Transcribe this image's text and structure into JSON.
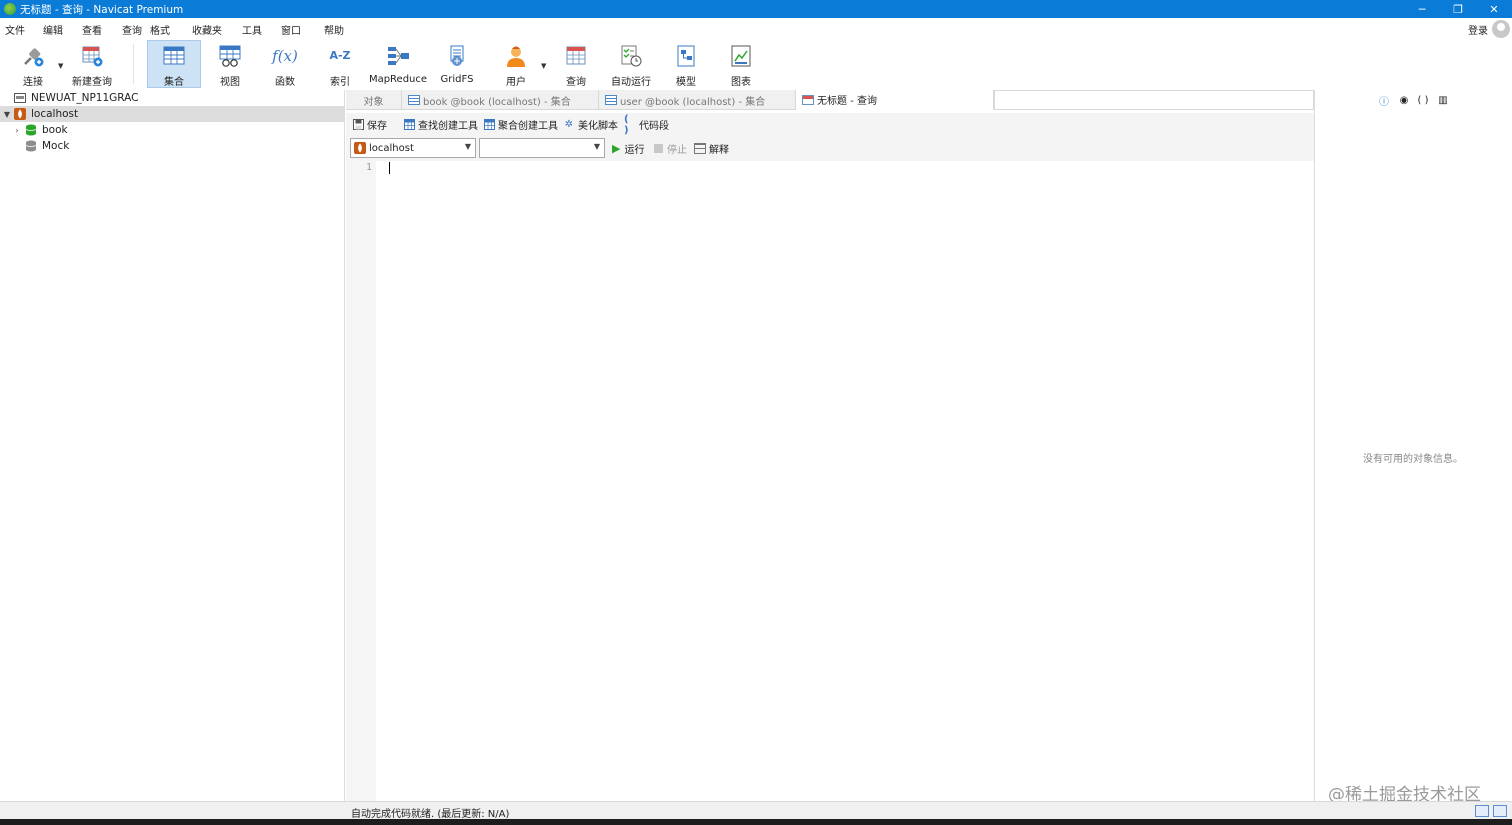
{
  "window": {
    "title": "无标题 - 查询 - Navicat Premium",
    "controls": [
      "─",
      "❐",
      "✕"
    ]
  },
  "menu": [
    "文件",
    "编辑",
    "查看",
    "查询",
    "格式",
    "收藏夹",
    "工具",
    "窗口",
    "帮助"
  ],
  "account": {
    "login": "登录"
  },
  "toolbar": {
    "items": [
      {
        "label": "连接",
        "icon": "plug-icon"
      },
      {
        "label": "新建查询",
        "icon": "new-query-icon"
      },
      {
        "label": "集合",
        "icon": "collection-icon"
      },
      {
        "label": "视图",
        "icon": "view-icon"
      },
      {
        "label": "函数",
        "icon": "function-icon",
        "glyph": "f(x)"
      },
      {
        "label": "索引",
        "icon": "index-icon",
        "glyph": "A-Z"
      },
      {
        "label": "MapReduce",
        "icon": "mapreduce-icon"
      },
      {
        "label": "GridFS",
        "icon": "gridfs-icon"
      },
      {
        "label": "用户",
        "icon": "user-icon"
      },
      {
        "label": "查询",
        "icon": "query-icon"
      },
      {
        "label": "自动运行",
        "icon": "autorun-icon"
      },
      {
        "label": "模型",
        "icon": "model-icon"
      },
      {
        "label": "图表",
        "icon": "chart-icon"
      }
    ]
  },
  "sidebar": {
    "tree": [
      {
        "label": "NEWUAT_NP11GRAC",
        "level": 0,
        "icon": "server-icon"
      },
      {
        "label": "localhost",
        "level": 0,
        "icon": "mongodb-icon",
        "expanded": true,
        "selected": true
      },
      {
        "label": "book",
        "level": 1,
        "icon": "database-green-icon",
        "collapsed": true
      },
      {
        "label": "Mock",
        "level": 1,
        "icon": "database-gray-icon"
      }
    ]
  },
  "tabs": [
    {
      "label": "对象"
    },
    {
      "label": "book @book (localhost) - 集合"
    },
    {
      "label": "user @book (localhost) - 集合"
    },
    {
      "label": "无标题 - 查询",
      "active": true
    }
  ],
  "editor_toolbar": {
    "save": "保存",
    "find_builder": "查找创建工具",
    "aggregate_builder": "聚合创建工具",
    "beautify": "美化脚本",
    "snippet": "代码段"
  },
  "run_bar": {
    "connection": "localhost",
    "database": "",
    "run": "运行",
    "stop": "停止",
    "explain": "解释"
  },
  "editor": {
    "line_numbers": [
      "1"
    ],
    "content": ""
  },
  "right_panel": {
    "empty_text": "没有可用的对象信息。",
    "icons": [
      "info-icon",
      "eye-icon",
      "braces-icon",
      "layout-icon"
    ]
  },
  "status": {
    "text": "自动完成代码就绪. (最后更新: N/A)"
  },
  "watermark": "@稀土掘金技术社区",
  "colors": {
    "titlebar": "#0a7bd6",
    "active_tool": "#cde3f5",
    "run_green": "#2aa62a"
  }
}
